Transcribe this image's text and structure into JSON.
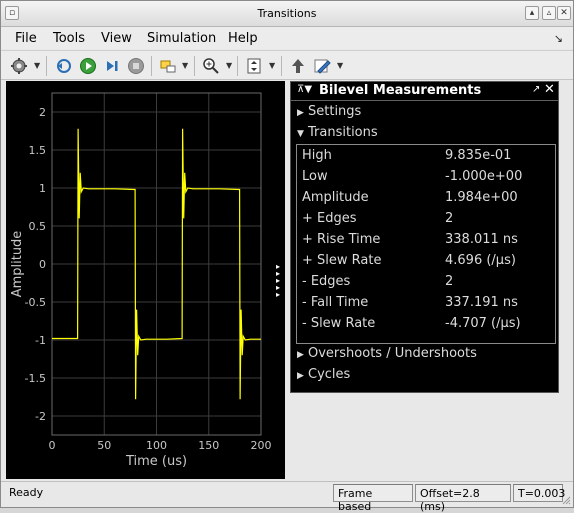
{
  "window": {
    "title": "Transitions"
  },
  "menu": [
    "File",
    "Tools",
    "View",
    "Simulation",
    "Help"
  ],
  "menu_underline": [
    "F",
    "T",
    "V",
    "S",
    "H"
  ],
  "toolbar": {
    "items": [
      "settings-icon",
      "step-back-icon",
      "run-icon",
      "step-forward-icon",
      "stop-icon",
      "highlight-icon",
      "zoom-in-icon",
      "scale-axes-icon",
      "bring-to-front-icon",
      "style-pen-icon"
    ]
  },
  "plot": {
    "ylabel": "Amplitude",
    "xlabel": "Time (us)"
  },
  "chart_data": {
    "type": "line",
    "title": "",
    "xlabel": "Time (us)",
    "ylabel": "Amplitude",
    "xlim": [
      0,
      200
    ],
    "ylim": [
      -2.25,
      2.25
    ],
    "xticks": [
      "0",
      "50",
      "100",
      "150",
      "200"
    ],
    "yticks": [
      "2",
      "1.5",
      "1",
      "0.5",
      "0",
      "-0.5",
      "-1",
      "-1.5",
      "-2"
    ],
    "grid": true,
    "line_color": "#ffff00",
    "series": [
      {
        "x": [
          0,
          24.5,
          25,
          26,
          27,
          28,
          30,
          35,
          60,
          79.5,
          80,
          81,
          82,
          83,
          85,
          90,
          110,
          124.5,
          125,
          126,
          127,
          128,
          130,
          135,
          160,
          179.5,
          180,
          181,
          182,
          183,
          185,
          190,
          200
        ],
        "y": [
          -0.98,
          -0.98,
          1.78,
          0.6,
          1.2,
          0.95,
          1.0,
          0.99,
          0.99,
          0.98,
          -1.78,
          -0.6,
          -1.2,
          -0.95,
          -1.0,
          -0.99,
          -0.99,
          -0.98,
          1.78,
          0.6,
          1.2,
          0.95,
          1.0,
          0.99,
          0.99,
          0.98,
          -1.78,
          -0.6,
          -1.2,
          -0.95,
          -1.0,
          -0.99,
          -0.99
        ]
      }
    ]
  },
  "panel": {
    "title": "Bilevel Measurements",
    "sections": {
      "settings": "Settings",
      "transitions": "Transitions",
      "overshoots": "Overshoots / Undershoots",
      "cycles": "Cycles"
    },
    "rows": [
      {
        "label": "High",
        "value": "9.835e-01"
      },
      {
        "label": "Low",
        "value": "-1.000e+00"
      },
      {
        "label": "Amplitude",
        "value": "1.984e+00"
      },
      {
        "label": "+ Edges",
        "value": "2"
      },
      {
        "label": "+ Rise Time",
        "value": "338.011 ns"
      },
      {
        "label": "+ Slew Rate",
        "value": "4.696 (/µs)"
      },
      {
        "label": "- Edges",
        "value": "2"
      },
      {
        "label": "- Fall Time",
        "value": "337.191 ns"
      },
      {
        "label": "- Slew Rate",
        "value": "-4.707 (/µs)"
      }
    ]
  },
  "status": {
    "left": "Ready",
    "mode": "Frame based",
    "offset": "Offset=2.8 (ms)",
    "time": "T=0.003"
  }
}
